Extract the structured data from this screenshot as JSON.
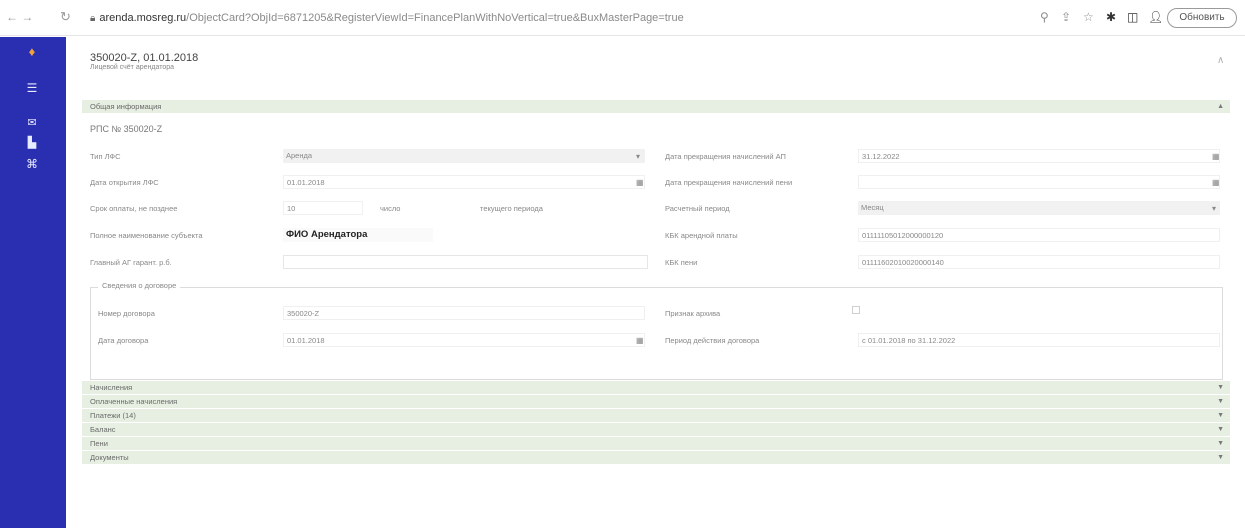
{
  "browser": {
    "url_host": "arenda.mosreg.ru",
    "url_path": "/ObjectCard?ObjId=6871205&RegisterViewId=FinancePlanWithNoVertical=true&BuxMasterPage=true",
    "update_button": "Обновить"
  },
  "header": {
    "title": "350020-Z, 01.01.2018",
    "subtitle": "Лицевой счёт арендатора",
    "collapse_icon": "chevron-up-icon"
  },
  "sections": {
    "general": "Общая информация",
    "accruals": "Начисления",
    "payments": "Оплаченные начисления",
    "penalties": "Платежи (14)",
    "balance": "Баланс",
    "fines": "Пени",
    "documents": "Документы"
  },
  "rpc": "РПС № 350020-Z",
  "fields": {
    "type_label": "Тип ЛФС",
    "type_value": "Аренда",
    "open_date_label": "Дата открытия ЛФС",
    "open_date_value": "01.01.2018",
    "pay_term_label": "Срок оплаты, не позднее",
    "pay_term_value": "10",
    "pay_term_unit": "число",
    "pay_term_period": "текущего периода",
    "tenant_name_label": "Полное наименование субъекта",
    "tenant_name_value": "ФИО Арендатора",
    "tenant_inn_label": "Главный АГ гарант. р.б.",
    "tenant_inn_value": "",
    "stop_accrual_label": "Дата прекращения начислений АП",
    "stop_accrual_value": "31.12.2022",
    "stop_fine_label": "Дата прекращения начислений пени",
    "stop_fine_value": "",
    "billing_period_label": "Расчетный период",
    "billing_period_value": "Месяц",
    "kbk_rent_label": "КБК арендной платы",
    "kbk_rent_value": "01111105012000000120",
    "kbk_fine_label": "КБК пени",
    "kbk_fine_value": "01111602010020000140"
  },
  "contract": {
    "legend": "Сведения о договоре",
    "number_label": "Номер договора",
    "number_value": "350020-Z",
    "date_label": "Дата договора",
    "date_value": "01.01.2018",
    "paused_label": "Признак архива",
    "period_label": "Период действия договора",
    "period_value": "с 01.01.2018 по 31.12.2022"
  }
}
